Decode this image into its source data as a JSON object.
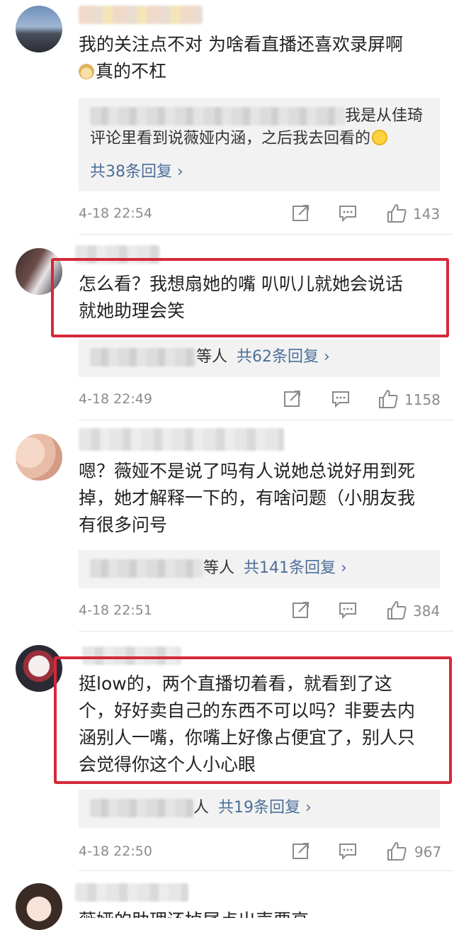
{
  "comments": [
    {
      "text_lines": [
        "我的关注点不对 为啥看直播还喜欢录屏啊",
        "真的不杠"
      ],
      "reply": {
        "lines": [
          "我是从佳琦",
          "评论里看到说薇娅内涵，之后我去回看的"
        ],
        "link": "共38条回复 ›"
      },
      "time": "4-18 22:54",
      "likes": "143"
    },
    {
      "text_lines": [
        "怎么看？我想扇她的嘴 叭叭儿就她会说话",
        "就她助理会笑"
      ],
      "reply": {
        "lines": [
          "等人"
        ],
        "link": "共62条回复 ›"
      },
      "time": "4-18 22:49",
      "likes": "1158"
    },
    {
      "text_lines": [
        "嗯？薇娅不是说了吗有人说她总说好用到死",
        "掉，她才解释一下的，有啥问题（小朋友我",
        "有很多问号"
      ],
      "reply": {
        "lines": [
          "等人"
        ],
        "link": "共141条回复 ›"
      },
      "time": "4-18 22:51",
      "likes": "384"
    },
    {
      "text_lines": [
        "挺low的，两个直播切着看，就看到了这",
        "个，好好卖自己的东西不可以吗？非要去内",
        "涵别人一嘴，你嘴上好像占便宜了，别人只",
        "会觉得你这个人小心眼"
      ],
      "reply": {
        "lines": [
          "人"
        ],
        "link": "共19条回复 ›"
      },
      "time": "4-18 22:50",
      "likes": "967"
    },
    {
      "text_lines": [
        "薇娅的助理还掉尾点出声要高"
      ],
      "time": "",
      "likes": ""
    }
  ],
  "colors": {
    "highlight": "#d6283b",
    "link": "#4c6f99",
    "meta": "#8b8b8b",
    "reply_bg": "#f2f2f2"
  },
  "icons": [
    "share-icon",
    "comment-icon",
    "thumbs-up-icon"
  ]
}
